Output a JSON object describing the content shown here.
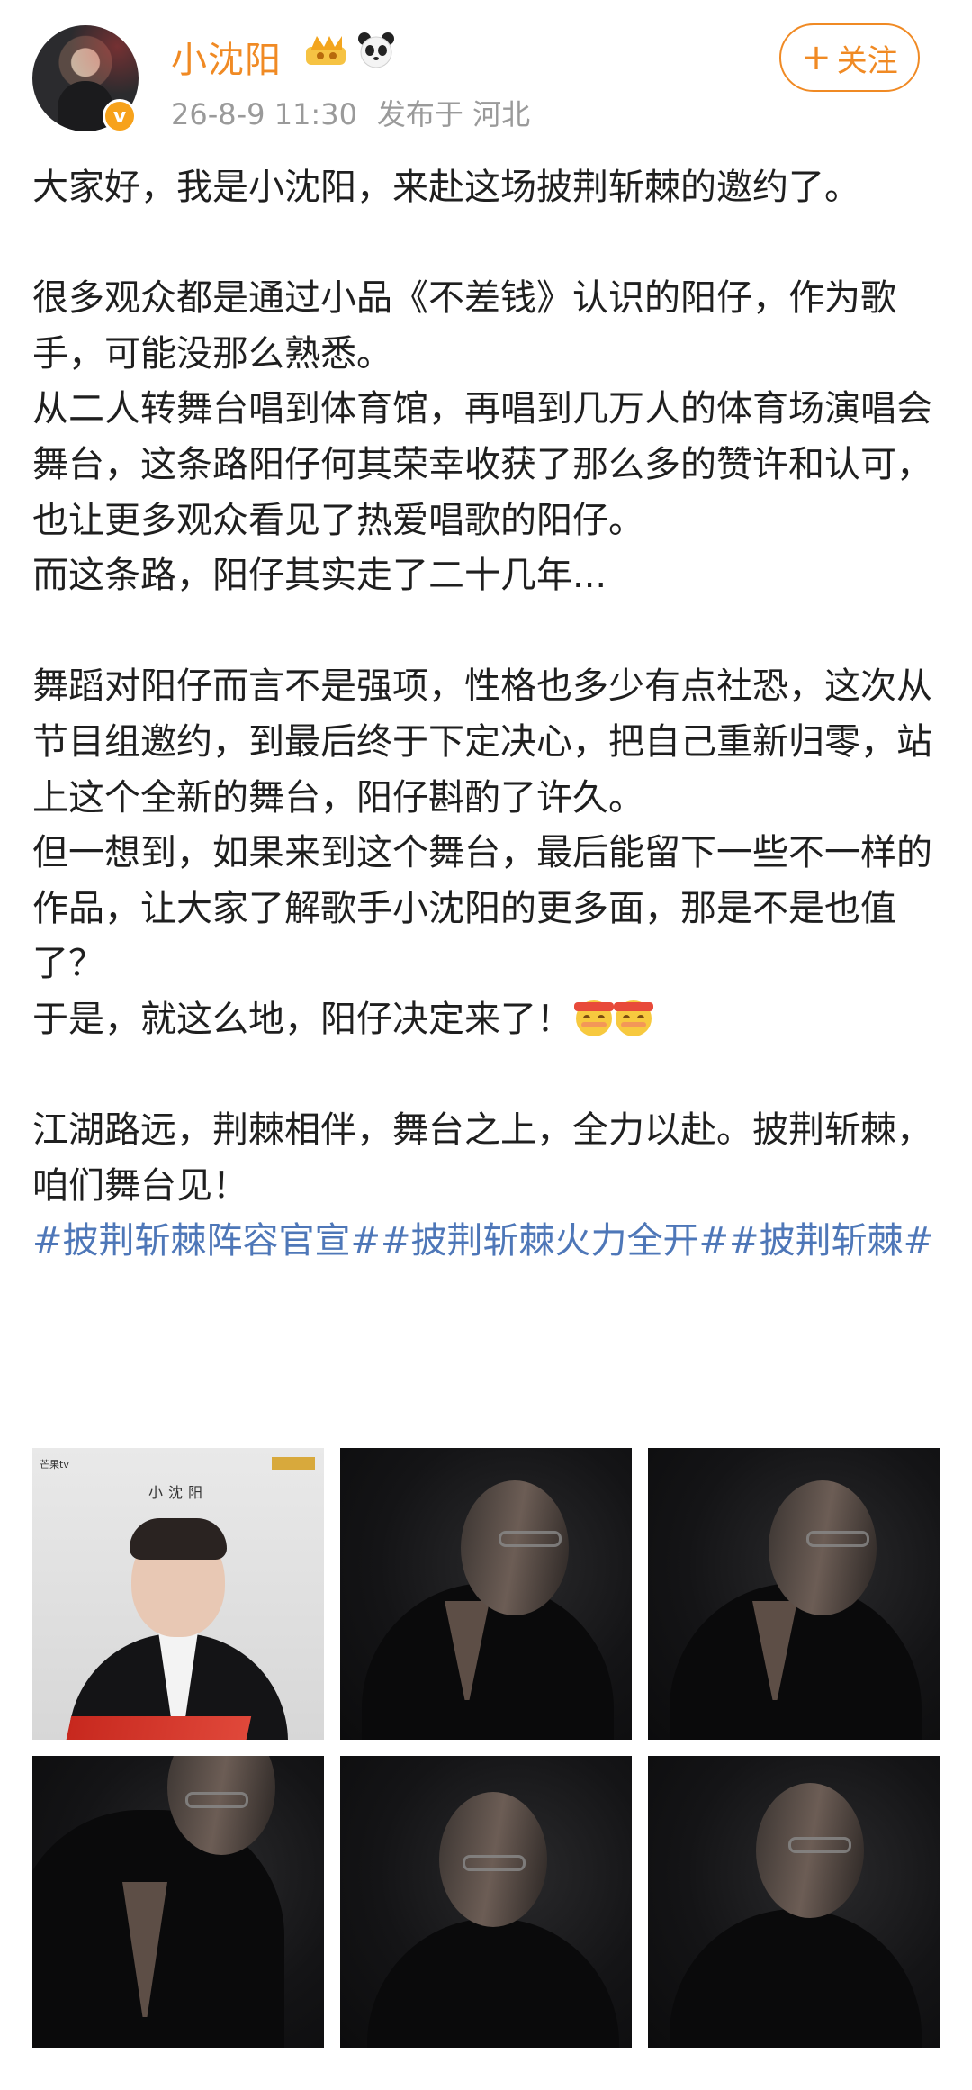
{
  "author": {
    "name": "小沈阳",
    "date_time": "26-8-9 11:30",
    "location": "发布于 河北"
  },
  "follow": {
    "plus": "+",
    "label": "关注"
  },
  "post": {
    "p1": "大家好，我是小沈阳，来赴这场披荆斩棘的邀约了。",
    "p2": "很多观众都是通过小品《不差钱》认识的阳仔，作为歌手，可能没那么熟悉。",
    "p3": "从二人转舞台唱到体育馆，再唱到几万人的体育场演唱会舞台，这条路阳仔何其荣幸收获了那么多的赞许和认可，也让更多观众看见了热爱唱歌的阳仔。",
    "p4": "而这条路，阳仔其实走了二十几年...",
    "p5": "舞蹈对阳仔而言不是强项，性格也多少有点社恐，这次从节目组邀约，到最后终于下定决心，把自己重新归零，站上这个全新的舞台，阳仔斟酌了许久。",
    "p6": "但一想到，如果来到这个舞台，最后能留下一些不一样的作品，让大家了解歌手小沈阳的更多面，那是不是也值了？",
    "p7": "于是，就这么地，阳仔决定来了！",
    "p8": "江湖路远，荆棘相伴，舞台之上，全力以赴。披荆斩棘，咱们舞台见！",
    "hashtags": "#披荆斩棘阵容官宣##披荆斩棘火力全开##披荆斩棘#"
  },
  "poster": {
    "channel": "芒果tv",
    "name": "小沈阳"
  },
  "colors": {
    "accent": "#f08a24",
    "link": "#4e77b8",
    "meta": "#9a9a9a"
  }
}
